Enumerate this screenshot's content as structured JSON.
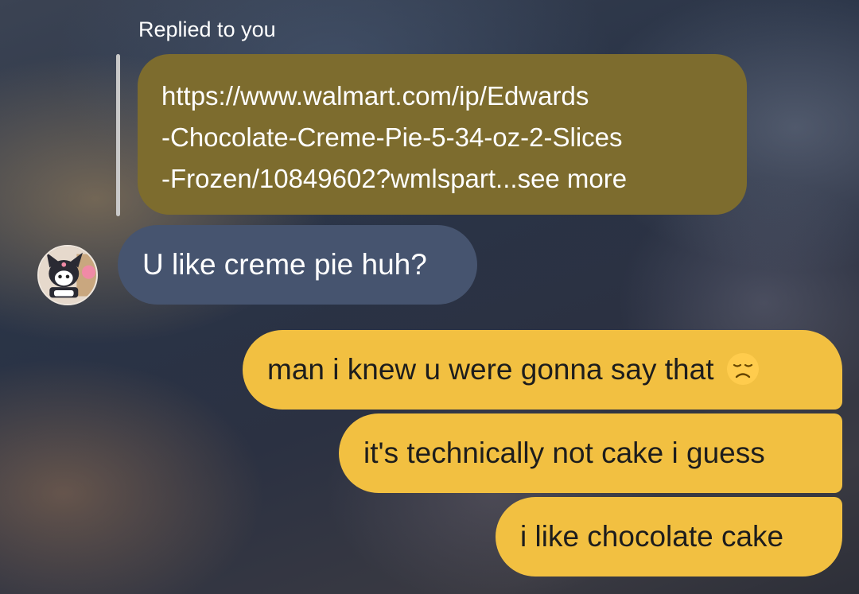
{
  "reply_context": {
    "label": "Replied to you",
    "quoted_lines": [
      "https://www.walmart.com/ip/Edwards",
      "-Chocolate-Creme-Pie-5-34-oz-2-Slices",
      "-Frozen/10849602?wmlspart...see more"
    ]
  },
  "messages": {
    "received": [
      {
        "text": "U like creme pie huh?"
      }
    ],
    "sent": [
      {
        "text": "man i knew u were gonna say that",
        "emoji": "disappointed-face-icon"
      },
      {
        "text": "it's technically not cake i guess"
      },
      {
        "text": "i like chocolate cake"
      }
    ]
  },
  "colors": {
    "quoted_bubble": "#7d6c2e",
    "received_bubble": "#46546f",
    "sent_bubble": "#f2c041",
    "sent_text": "#1d1d1d"
  }
}
